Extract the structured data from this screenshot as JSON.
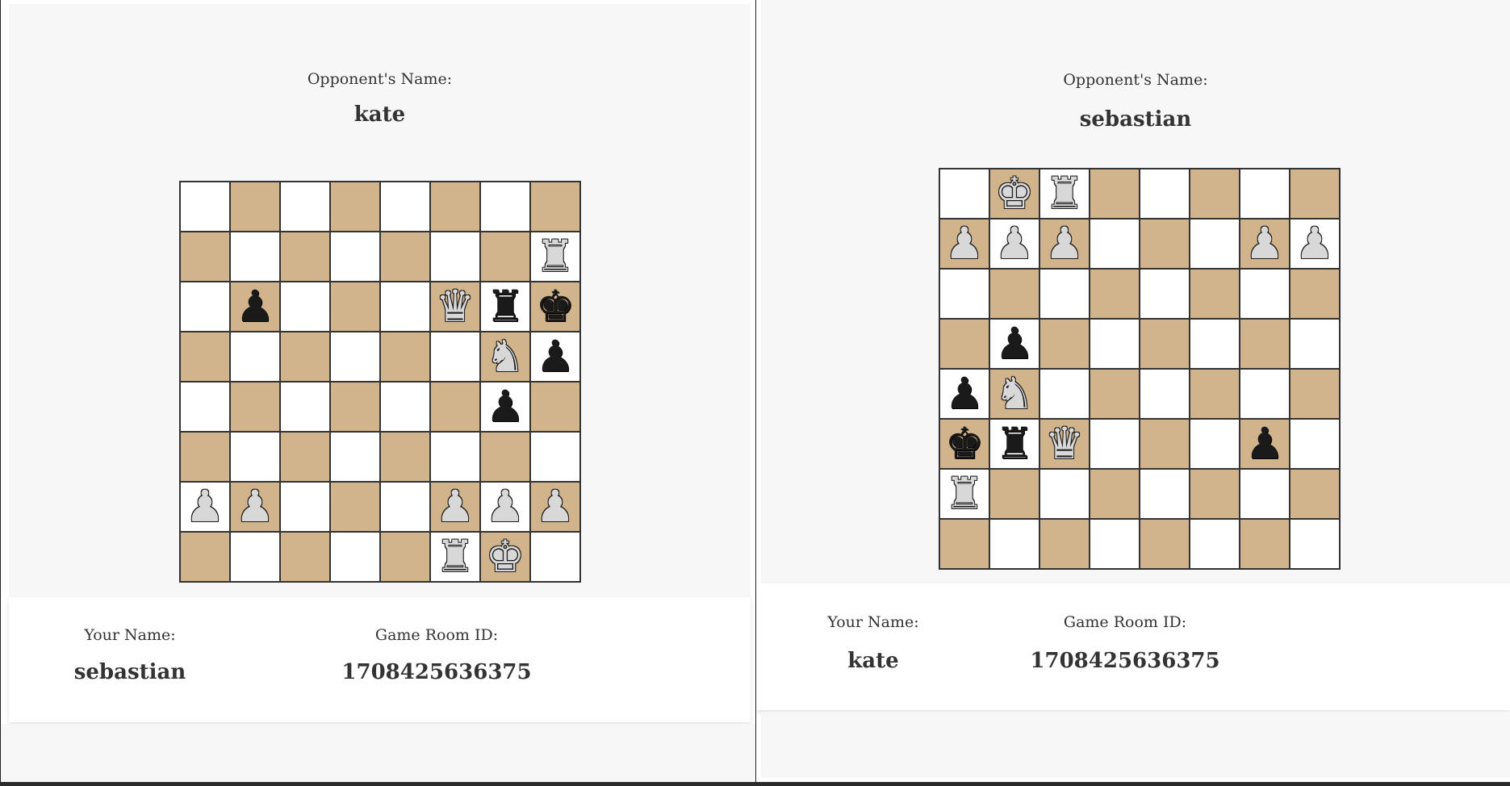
{
  "left_window": {
    "opponent_label": "Opponent's Name:",
    "opponent_name": "kate",
    "your_name_label": "Your Name:",
    "your_name": "sebastian",
    "room_label": "Game Room ID:",
    "room_id": "1708425636375",
    "board": [
      [
        "",
        "",
        "",
        "",
        "",
        "",
        "",
        ""
      ],
      [
        "",
        "",
        "",
        "",
        "",
        "",
        "",
        "wR"
      ],
      [
        "",
        "bP",
        "",
        "",
        "",
        "wQ",
        "bR",
        "bK"
      ],
      [
        "",
        "",
        "",
        "",
        "",
        "",
        "wN",
        "bP"
      ],
      [
        "",
        "",
        "",
        "",
        "",
        "",
        "bP",
        ""
      ],
      [
        "",
        "",
        "",
        "",
        "",
        "",
        "",
        ""
      ],
      [
        "wP",
        "wP",
        "",
        "",
        "",
        "wP",
        "wP",
        "wP"
      ],
      [
        "",
        "",
        "",
        "",
        "",
        "wR",
        "wK",
        ""
      ]
    ]
  },
  "right_window": {
    "opponent_label": "Opponent's Name:",
    "opponent_name": "sebastian",
    "your_name_label": "Your Name:",
    "your_name": "kate",
    "room_label": "Game Room ID:",
    "room_id": "1708425636375",
    "board": [
      [
        "",
        "wK",
        "wR",
        "",
        "",
        "",
        "",
        ""
      ],
      [
        "wP",
        "wP",
        "wP",
        "",
        "",
        "",
        "wP",
        "wP"
      ],
      [
        "",
        "",
        "",
        "",
        "",
        "",
        "",
        ""
      ],
      [
        "",
        "bP",
        "",
        "",
        "",
        "",
        "",
        ""
      ],
      [
        "bP",
        "wN",
        "",
        "",
        "",
        "",
        "",
        ""
      ],
      [
        "bK",
        "bR",
        "wQ",
        "",
        "",
        "",
        "bP",
        ""
      ],
      [
        "wR",
        "",
        "",
        "",
        "",
        "",
        "",
        ""
      ],
      [
        "",
        "",
        "",
        "",
        "",
        "",
        "",
        ""
      ]
    ]
  },
  "colors": {
    "light_square": "#ffffff",
    "dark_square": "#d2b48c",
    "page_background": "#f7f7f7"
  }
}
